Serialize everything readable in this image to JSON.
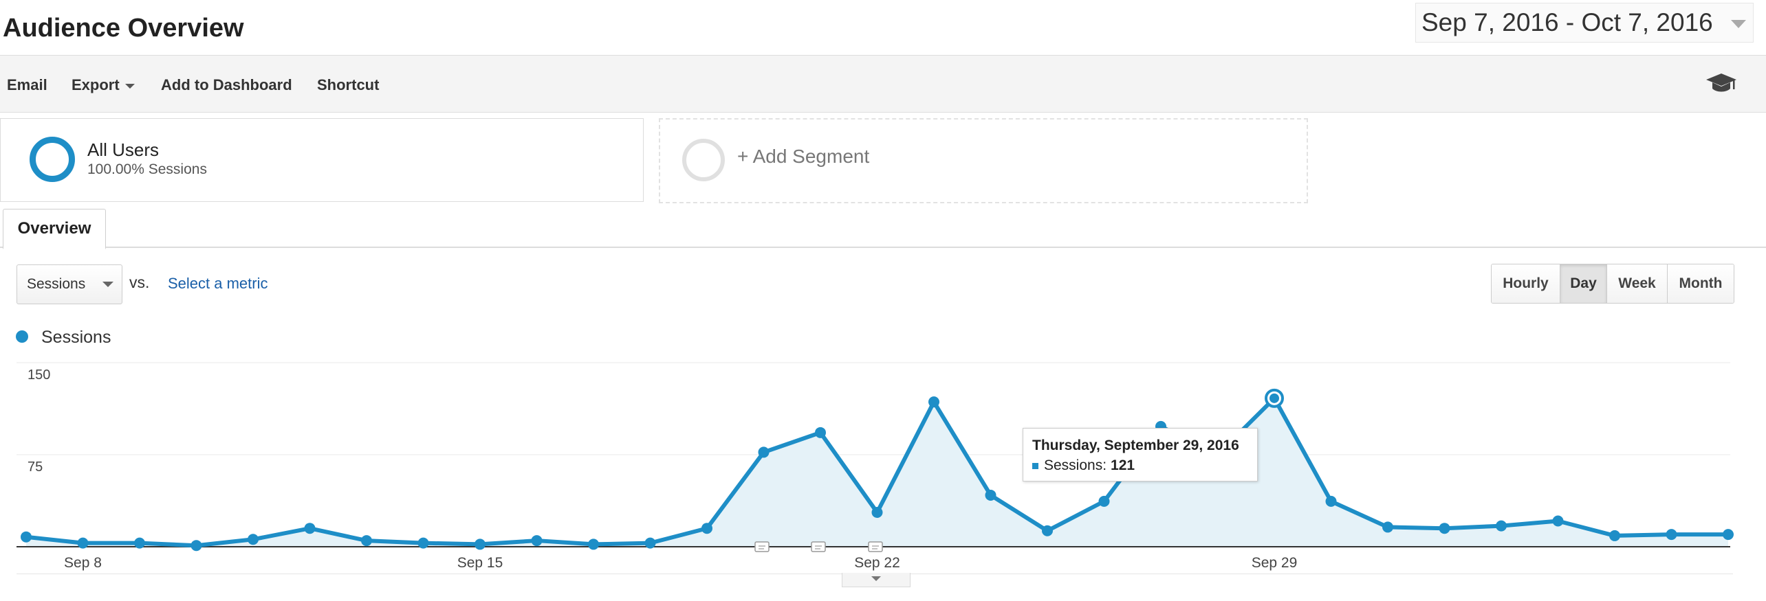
{
  "header": {
    "title": "Audience Overview",
    "date_range": "Sep 7, 2016 - Oct 7, 2016"
  },
  "toolbar": {
    "email": "Email",
    "export": "Export",
    "add_to_dashboard": "Add to Dashboard",
    "shortcut": "Shortcut",
    "help_icon": "graduation-cap-icon"
  },
  "segments": {
    "active": {
      "name": "All Users",
      "detail": "100.00% Sessions",
      "color": "#1e8ec7"
    },
    "add_label": "+ Add Segment"
  },
  "tabs": {
    "overview": "Overview"
  },
  "controls": {
    "metric": "Sessions",
    "vs": "vs.",
    "select_metric": "Select a metric",
    "granularity": [
      "Hourly",
      "Day",
      "Week",
      "Month"
    ],
    "active_granularity": "Day"
  },
  "legend": {
    "label": "Sessions",
    "color": "#1e8ec7"
  },
  "chart_data": {
    "type": "area",
    "series": [
      {
        "name": "Sessions",
        "values": [
          8,
          3,
          3,
          1,
          6,
          15,
          5,
          3,
          2,
          5,
          2,
          3,
          15,
          77,
          93,
          28,
          118,
          42,
          13,
          37,
          98,
          75,
          121,
          37,
          16,
          15,
          17,
          21,
          9,
          10,
          10
        ]
      }
    ],
    "x_start": "2016-09-07",
    "x_ticks": [
      "Sep 8",
      "Sep 15",
      "Sep 22",
      "Sep 29"
    ],
    "y_ticks": [
      150,
      75
    ],
    "ylim": [
      0,
      150
    ],
    "annotation_markers": [
      2,
      3,
      4
    ],
    "line_color": "#1e8ec7",
    "fill_color": "#e5f2f8",
    "grid": true
  },
  "tooltip": {
    "date": "Thursday, September 29, 2016",
    "label": "Sessions:",
    "value": "121"
  }
}
